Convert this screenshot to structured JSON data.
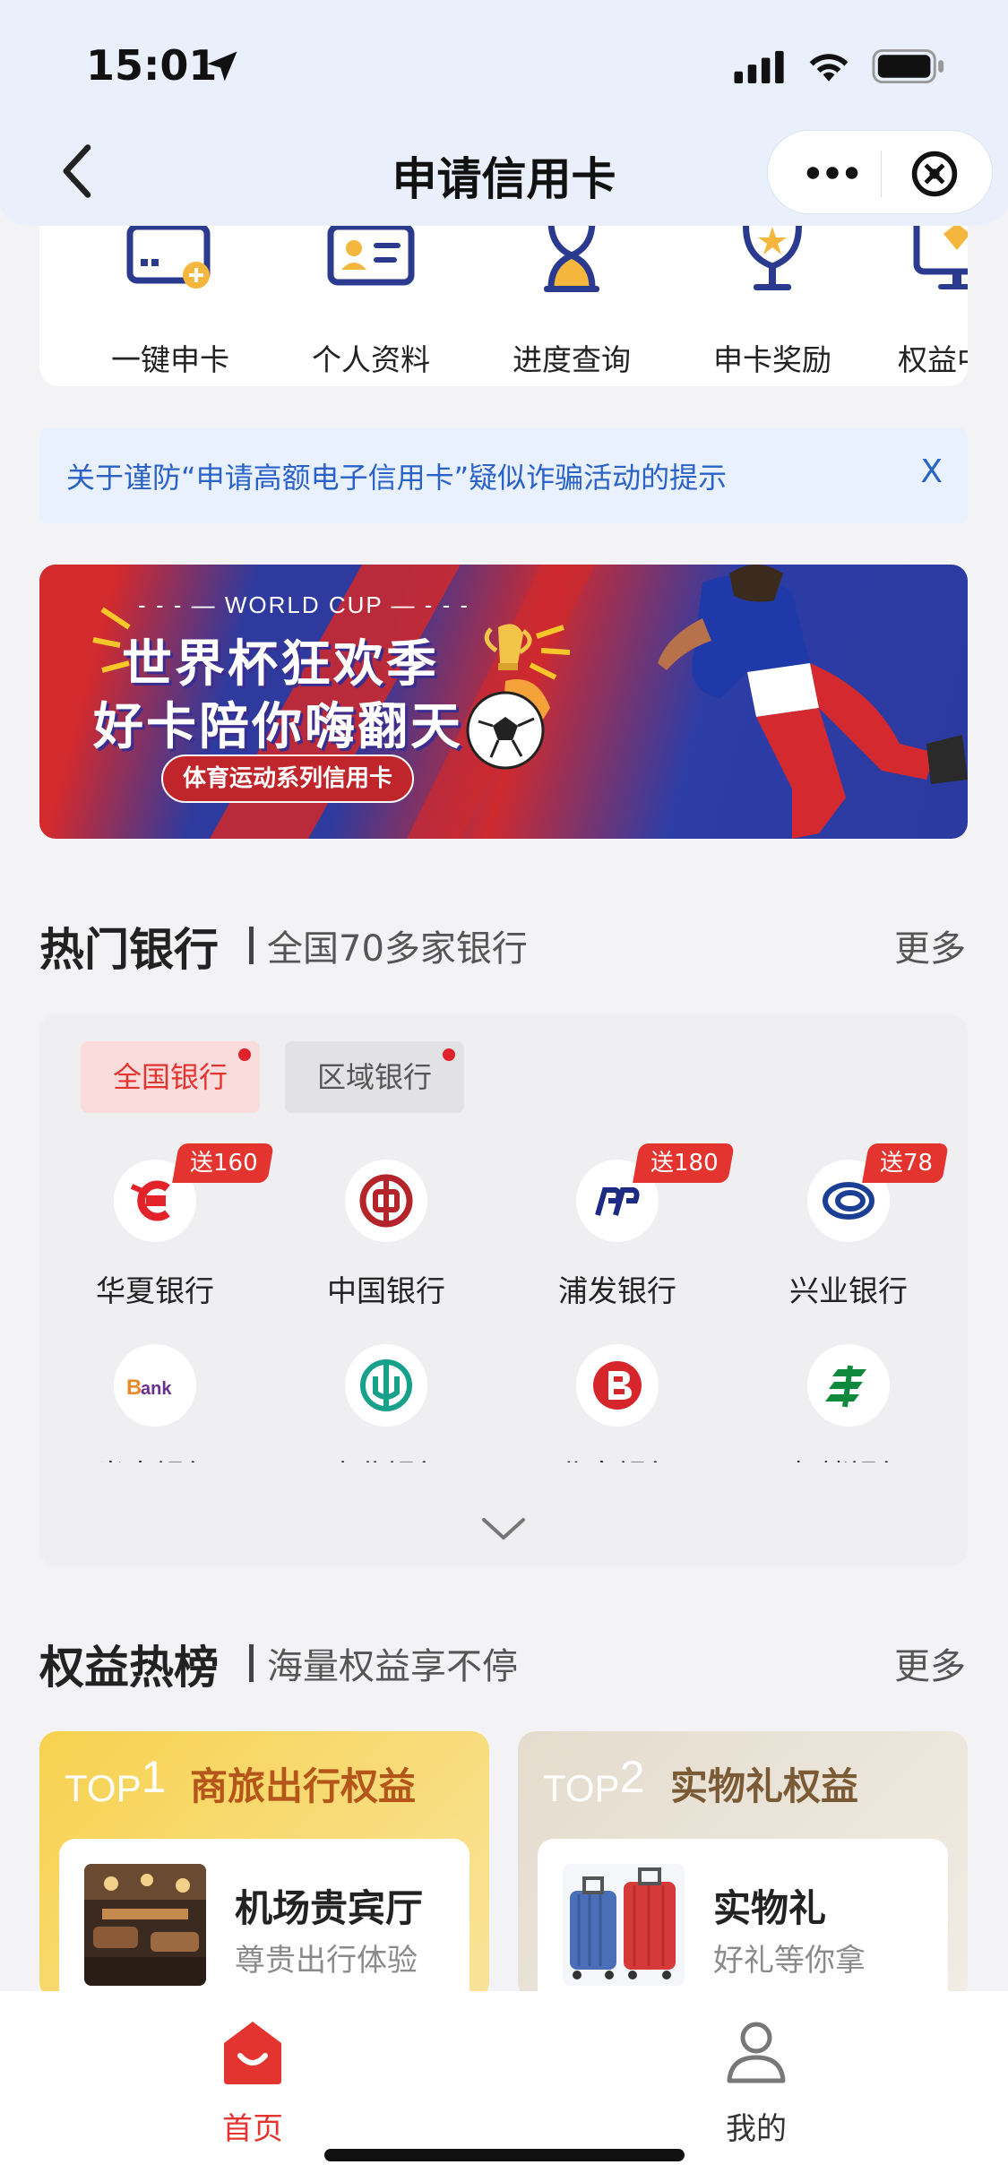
{
  "status_bar": {
    "time": "15:01"
  },
  "nav": {
    "title": "申请信用卡"
  },
  "quick_entries": [
    {
      "label": "一键申卡",
      "icon": "card-plus-icon"
    },
    {
      "label": "个人资料",
      "icon": "id-card-icon"
    },
    {
      "label": "进度查询",
      "icon": "hourglass-icon"
    },
    {
      "label": "申卡奖励",
      "icon": "trophy-icon"
    },
    {
      "label": "权益中心",
      "icon": "vip-monitor-icon"
    }
  ],
  "notice": {
    "text": "关于谨防“申请高额电子信用卡”疑似诈骗活动的提示",
    "close": "X"
  },
  "banner": {
    "kicker": "- - - — WORLD CUP — - - -",
    "line1": "世界杯狂欢季",
    "line2": "好卡陪你嗨翻天",
    "button": "体育运动系列信用卡"
  },
  "hot_banks": {
    "title": "热门银行",
    "subtitle": "全国70多家银行",
    "more": "更多",
    "tabs": [
      {
        "label": "全国银行",
        "active": true
      },
      {
        "label": "区域银行",
        "active": false
      }
    ],
    "banks": [
      {
        "name": "华夏银行",
        "gift": "送160",
        "color": "#e2232a"
      },
      {
        "name": "中国银行",
        "gift": "",
        "color": "#b3252a"
      },
      {
        "name": "浦发银行",
        "gift": "送180",
        "color": "#1c2b84"
      },
      {
        "name": "兴业银行",
        "gift": "送78",
        "color": "#1b3f95"
      },
      {
        "name": "光大银行",
        "gift": "",
        "color": "#6a2f8e"
      },
      {
        "name": "农业银行",
        "gift": "",
        "color": "#17a08a"
      },
      {
        "name": "北京银行",
        "gift": "",
        "color": "#d6262c"
      },
      {
        "name": "邮储银行",
        "gift": "",
        "color": "#0f8a3c"
      }
    ]
  },
  "rights": {
    "title": "权益热榜",
    "subtitle": "海量权益享不停",
    "more": "更多",
    "cards": [
      {
        "rank_prefix": "TOP",
        "rank": "1",
        "title": "商旅出行权益",
        "item_name": "机场贵宾厅",
        "item_desc": "尊贵出行体验"
      },
      {
        "rank_prefix": "TOP",
        "rank": "2",
        "title": "实物礼权益",
        "item_name": "实物礼",
        "item_desc": "好礼等你拿"
      }
    ]
  },
  "tabbar": [
    {
      "label": "首页",
      "active": true,
      "color": "#e4342f"
    },
    {
      "label": "我的",
      "active": false,
      "color": "#333333"
    }
  ]
}
